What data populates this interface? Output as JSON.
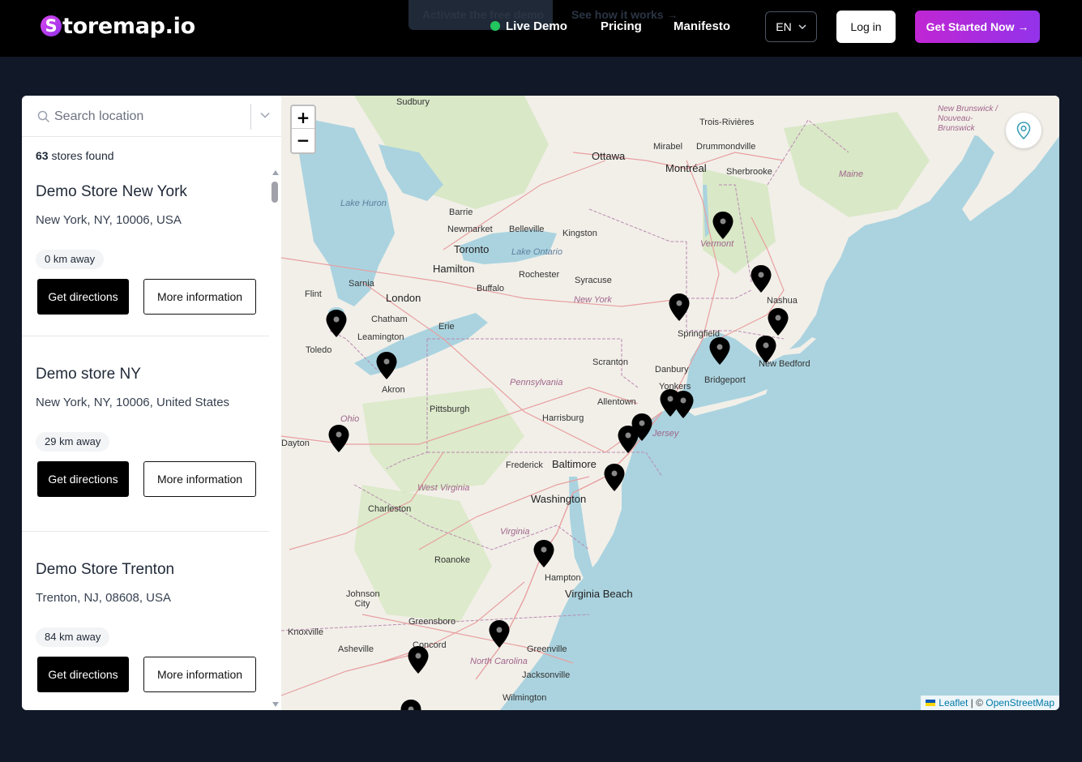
{
  "header": {
    "logo_letter": "S",
    "logo_text": "toremap.io",
    "ghost_primary": "Activate the free demo",
    "ghost_secondary": "See how it works →",
    "nav": {
      "live_demo": "Live Demo",
      "pricing": "Pricing",
      "manifesto": "Manifesto"
    },
    "language": "EN",
    "login_label": "Log in",
    "cta_label": "Get Started Now →"
  },
  "sidebar": {
    "search_placeholder": "Search location",
    "count_value": "63",
    "count_suffix": "stores found",
    "stores": [
      {
        "name": "Demo Store New York",
        "address": "New York, NY, 10006, USA",
        "distance": "0 km away",
        "directions_label": "Get directions",
        "info_label": "More information"
      },
      {
        "name": "Demo store NY",
        "address": "New York, NY, 10006, United States",
        "distance": "29 km away",
        "directions_label": "Get directions",
        "info_label": "More information"
      },
      {
        "name": "Demo Store Trenton",
        "address": "Trenton, NJ, 08608, USA",
        "distance": "84 km away",
        "directions_label": "Get directions",
        "info_label": "More information"
      }
    ]
  },
  "map": {
    "zoom_in": "+",
    "zoom_out": "−",
    "attribution_leaflet": "Leaflet",
    "attribution_sep": " | © ",
    "attribution_osm": "OpenStreetMap",
    "labels": [
      {
        "text": "Sudbury",
        "kind": "town"
      },
      {
        "text": "Trois-Rivières",
        "kind": "town"
      },
      {
        "text": "Ottawa",
        "kind": "city"
      },
      {
        "text": "Mirabel",
        "kind": "town"
      },
      {
        "text": "Drummondville",
        "kind": "town"
      },
      {
        "text": "Montréal",
        "kind": "city"
      },
      {
        "text": "Sherbrooke",
        "kind": "town"
      },
      {
        "text": "Maine",
        "kind": "state"
      },
      {
        "text": "New Brunswick / Nouveau-Brunswick",
        "kind": "state"
      },
      {
        "text": "Lake Huron",
        "kind": "water"
      },
      {
        "text": "Barrie",
        "kind": "town"
      },
      {
        "text": "Newmarket",
        "kind": "town"
      },
      {
        "text": "Belleville",
        "kind": "town"
      },
      {
        "text": "Kingston",
        "kind": "town"
      },
      {
        "text": "Toronto",
        "kind": "city"
      },
      {
        "text": "Lake Ontario",
        "kind": "water"
      },
      {
        "text": "Vermont",
        "kind": "state"
      },
      {
        "text": "Hamilton",
        "kind": "city"
      },
      {
        "text": "Rochester",
        "kind": "town"
      },
      {
        "text": "Syracuse",
        "kind": "town"
      },
      {
        "text": "Sarnia",
        "kind": "town"
      },
      {
        "text": "Buffalo",
        "kind": "town"
      },
      {
        "text": "London",
        "kind": "city"
      },
      {
        "text": "Flint",
        "kind": "town"
      },
      {
        "text": "New York",
        "kind": "state"
      },
      {
        "text": "Nashua",
        "kind": "town"
      },
      {
        "text": "Chatham",
        "kind": "town"
      },
      {
        "text": "Erie",
        "kind": "town"
      },
      {
        "text": "Springfield",
        "kind": "town"
      },
      {
        "text": "Leamington",
        "kind": "town"
      },
      {
        "text": "Toledo",
        "kind": "town"
      },
      {
        "text": "New Bedford",
        "kind": "town"
      },
      {
        "text": "Scranton",
        "kind": "town"
      },
      {
        "text": "Danbury",
        "kind": "town"
      },
      {
        "text": "Akron",
        "kind": "town"
      },
      {
        "text": "Bridgeport",
        "kind": "town"
      },
      {
        "text": "Pennsylvania",
        "kind": "state"
      },
      {
        "text": "Yonkers",
        "kind": "town"
      },
      {
        "text": "Allentown",
        "kind": "town"
      },
      {
        "text": "Pittsburgh",
        "kind": "town"
      },
      {
        "text": "Ohio",
        "kind": "state"
      },
      {
        "text": "Harrisburg",
        "kind": "town"
      },
      {
        "text": "Jersey",
        "kind": "state"
      },
      {
        "text": "Dayton",
        "kind": "town"
      },
      {
        "text": "Frederick",
        "kind": "town"
      },
      {
        "text": "Baltimore",
        "kind": "city"
      },
      {
        "text": "West Virginia",
        "kind": "state"
      },
      {
        "text": "Washington",
        "kind": "city"
      },
      {
        "text": "Charleston",
        "kind": "town"
      },
      {
        "text": "Virginia",
        "kind": "state"
      },
      {
        "text": "Roanoke",
        "kind": "town"
      },
      {
        "text": "Hampton",
        "kind": "town"
      },
      {
        "text": "Johnson City",
        "kind": "town"
      },
      {
        "text": "Virginia Beach",
        "kind": "city"
      },
      {
        "text": "Greensboro",
        "kind": "town"
      },
      {
        "text": "Knoxville",
        "kind": "town"
      },
      {
        "text": "Asheville",
        "kind": "town"
      },
      {
        "text": "Concord",
        "kind": "town"
      },
      {
        "text": "Greenville",
        "kind": "town"
      },
      {
        "text": "North Carolina",
        "kind": "state"
      },
      {
        "text": "Jacksonville",
        "kind": "town"
      },
      {
        "text": "Wilmington",
        "kind": "town"
      }
    ]
  }
}
